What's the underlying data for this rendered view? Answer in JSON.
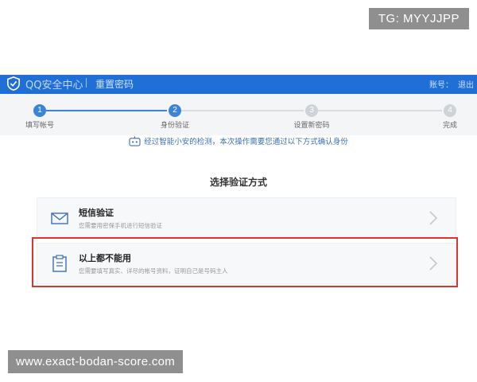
{
  "watermark": {
    "tg": "TG: MYYJJPP",
    "url": "www.exact-bodan-score.com"
  },
  "header": {
    "brand": "QQ安全中心",
    "sub": "重置密码",
    "account": "账号：",
    "exit": "退出"
  },
  "steps": [
    {
      "num": "1",
      "label": "填写帐号",
      "state": "done"
    },
    {
      "num": "2",
      "label": "身份验证",
      "state": "active"
    },
    {
      "num": "3",
      "label": "设置新密码",
      "state": "pending"
    },
    {
      "num": "4",
      "label": "完成",
      "state": "pending"
    }
  ],
  "notice": {
    "text": "经过智能小安的检测，本次操作需要您通过以下方式确认身份",
    "icon": "robot-icon"
  },
  "panel": {
    "title": "选择验证方式",
    "options": [
      {
        "title": "短信验证",
        "desc": "您需要用密保手机进行短信验证",
        "icon": "envelope-icon"
      },
      {
        "title": "以上都不能用",
        "desc": "您需要填写真实、详尽的帐号资料，证明自己是号码主人",
        "icon": "clipboard-icon"
      }
    ]
  },
  "colors": {
    "header_blue": "#1f6fd6",
    "step_active": "#3b85d8",
    "highlight_red": "#dd3333"
  }
}
